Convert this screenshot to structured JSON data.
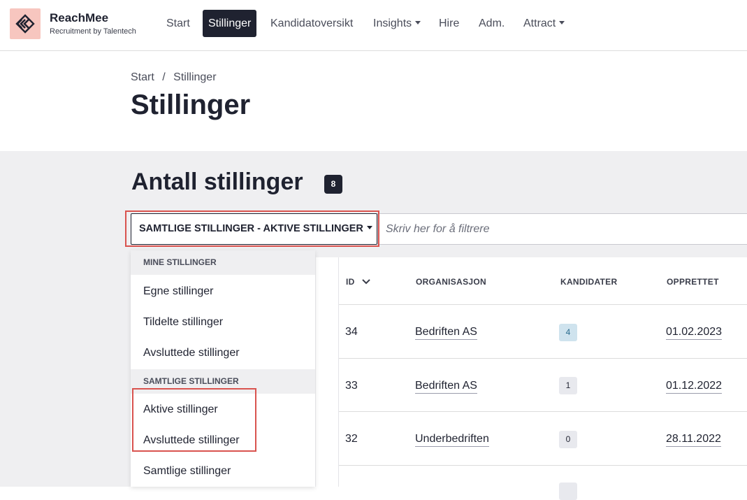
{
  "brand": {
    "name": "ReachMee",
    "subtitle": "Recruitment by Talentech",
    "logo_icon": "reachmee-logo-icon",
    "logo_bg": "#f7c6bf"
  },
  "nav": {
    "items": [
      {
        "label": "Start"
      },
      {
        "label": "Stillinger",
        "active": true
      },
      {
        "label": "Kandidatoversikt"
      },
      {
        "label": "Insights",
        "dropdown": true
      },
      {
        "label": "Hire"
      },
      {
        "label": "Adm."
      },
      {
        "label": "Attract",
        "dropdown": true
      }
    ]
  },
  "breadcrumb": {
    "items": [
      "Start",
      "Stillinger"
    ],
    "separator": "/"
  },
  "page_title": "Stillinger",
  "count": {
    "title": "Antall stillinger",
    "value": "8"
  },
  "filter": {
    "dropdown_label": "SAMTLIGE STILLINGER - AKTIVE STILLINGER",
    "search_placeholder": "Skriv her for å filtrere"
  },
  "dropdown_menu": {
    "groups": [
      {
        "label": "MINE STILLINGER",
        "items": [
          "Egne stillinger",
          "Tildelte stillinger",
          "Avsluttede stillinger"
        ]
      },
      {
        "label": "SAMTLIGE STILLINGER",
        "items": [
          "Aktive stillinger",
          "Avsluttede stillinger",
          "Samtlige stillinger"
        ]
      }
    ]
  },
  "table": {
    "columns": [
      "ID",
      "ORGANISASJON",
      "KANDIDATER",
      "OPPRETTET"
    ],
    "sort_icon": "chevron-down-icon",
    "rows": [
      {
        "id": "34",
        "org": "Bedriften AS",
        "candidates": "4",
        "created": "01.02.2023"
      },
      {
        "id": "33",
        "org": "Bedriften AS",
        "candidates": "1",
        "created": "01.12.2022"
      },
      {
        "id": "32",
        "org": "Underbedriften",
        "candidates": "0",
        "created": "28.11.2022"
      }
    ]
  },
  "colors": {
    "accent_dark": "#1f2230",
    "highlight_outline": "#d9534f",
    "grey_bg": "#efeff1",
    "badge_highlight": "#cfe3ee"
  }
}
